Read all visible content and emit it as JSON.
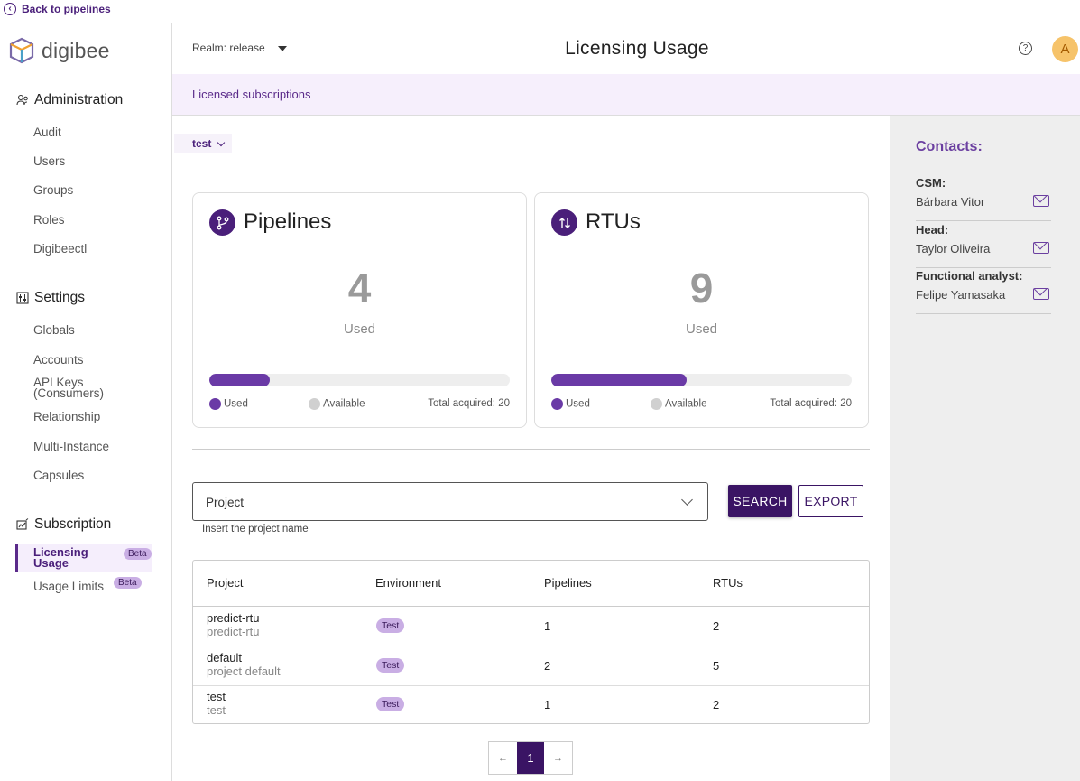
{
  "topbar": {
    "back_label": "Back to pipelines"
  },
  "sidebar": {
    "logo_text": "digibee",
    "sections": {
      "administration": {
        "title": "Administration",
        "items": [
          "Audit",
          "Users",
          "Groups",
          "Roles",
          "Digibeectl"
        ]
      },
      "settings": {
        "title": "Settings",
        "items": [
          "Globals",
          "Accounts",
          "API Keys\n(Consumers)",
          "Relationship",
          "Multi-Instance",
          "Capsules"
        ]
      },
      "subscription": {
        "title": "Subscription",
        "items": [
          "Licensing\nUsage",
          "Usage Limits"
        ]
      }
    },
    "beta_label": "Beta"
  },
  "header": {
    "realm_label": "Realm: release",
    "title": "Licensing Usage",
    "avatar_initial": "A"
  },
  "banner": {
    "label": "Licensed subscriptions"
  },
  "env_selector": {
    "value": "test"
  },
  "cards": {
    "pipelines": {
      "title": "Pipelines",
      "used_value": "4",
      "used_label": "Used",
      "used_fraction": 0.2,
      "legend_used": "Used",
      "legend_available": "Available",
      "total_label": "Total acquired: 20"
    },
    "rtus": {
      "title": "RTUs",
      "used_value": "9",
      "used_label": "Used",
      "used_fraction": 0.45,
      "legend_used": "Used",
      "legend_available": "Available",
      "total_label": "Total acquired: 20"
    }
  },
  "filter": {
    "placeholder": "Project",
    "helper": "Insert the project name",
    "search_label": "SEARCH",
    "export_label": "EXPORT"
  },
  "table": {
    "headers": [
      "Project",
      "Environment",
      "Pipelines",
      "RTUs"
    ],
    "rows": [
      {
        "name": "predict-rtu",
        "description": "predict-rtu",
        "environment": "Test",
        "pipelines": "1",
        "rtus": "2"
      },
      {
        "name": "default",
        "description": "project default",
        "environment": "Test",
        "pipelines": "2",
        "rtus": "5"
      },
      {
        "name": "test",
        "description": "test",
        "environment": "Test",
        "pipelines": "1",
        "rtus": "2"
      }
    ]
  },
  "pagination": {
    "prev": "←",
    "current": "1",
    "next": "→"
  },
  "contacts": {
    "title": "Contacts:",
    "items": [
      {
        "role": "CSM:",
        "name": "Bárbara Vitor"
      },
      {
        "role": "Head:",
        "name": "Taylor Oliveira"
      },
      {
        "role": "Functional analyst:",
        "name": "Felipe Yamasaka"
      }
    ]
  },
  "colors": {
    "brand": "#4a1f7a",
    "accent": "#6a3aa6",
    "banner": "#f6effc",
    "badge": "#c9aee4"
  }
}
